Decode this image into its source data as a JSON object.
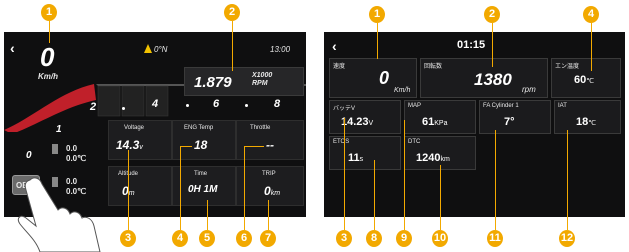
{
  "left_screen": {
    "speed": {
      "value": "0",
      "unit": "Km/h"
    },
    "compass": "0°N",
    "clock": "13:00",
    "rpm": {
      "value": "1.879",
      "unit_line1": "X1000",
      "unit_line2": "RPM"
    },
    "scale_ticks": [
      "2",
      "4",
      "6",
      "8"
    ],
    "gear_labels": [
      "1",
      "0"
    ],
    "side_readouts": [
      "0.0",
      "0.0℃",
      "0.0",
      "0.0℃"
    ],
    "obd_button": "OBD",
    "gauges": [
      {
        "label": "Voltage",
        "value": "14.3",
        "unit": "v"
      },
      {
        "label": "ENG Temp",
        "value": "18",
        "unit": ""
      },
      {
        "label": "Throttle",
        "value": "--",
        "unit": ""
      },
      {
        "label": "Altitude",
        "value": "0",
        "unit": "m"
      },
      {
        "label": "Time",
        "value": "0H 1M",
        "unit": ""
      },
      {
        "label": "TRIP",
        "value": "0",
        "unit": "km"
      }
    ]
  },
  "right_screen": {
    "clock": "01:15",
    "tiles": [
      {
        "label": "速度",
        "value": "0",
        "unit": "Km/h"
      },
      {
        "label": "回転数",
        "value": "1380",
        "unit": "rpm"
      },
      {
        "label": "エン温度",
        "value": "60",
        "unit": "℃"
      },
      {
        "label": "バッテV",
        "value": "14.23",
        "unit": "V"
      },
      {
        "label": "MAP",
        "value": "61",
        "unit": "KPa"
      },
      {
        "label": "FA Cylinder 1",
        "value": "7°",
        "unit": ""
      },
      {
        "label": "IAT",
        "value": "18",
        "unit": "℃"
      },
      {
        "label": "ETOS",
        "value": "11",
        "unit": "s"
      },
      {
        "label": "DTC",
        "value": "1240",
        "unit": "km"
      }
    ]
  },
  "callouts": [
    "1",
    "2",
    "3",
    "4",
    "5",
    "6",
    "7",
    "1",
    "2",
    "4",
    "3",
    "8",
    "9",
    "10",
    "11",
    "12"
  ],
  "colors": {
    "marker": "#f2a900",
    "background": "#0f0f10",
    "accent_red": "#c0202a"
  }
}
